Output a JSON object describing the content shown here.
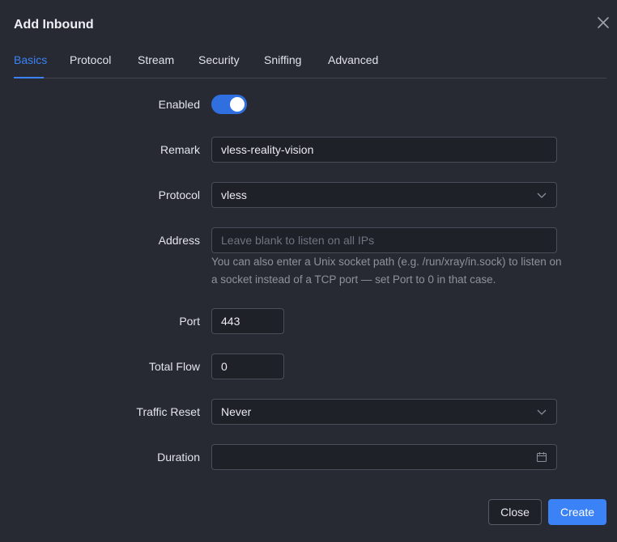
{
  "dialog": {
    "title": "Add Inbound"
  },
  "tabs": [
    {
      "label": "Basics"
    },
    {
      "label": "Protocol"
    },
    {
      "label": "Stream"
    },
    {
      "label": "Security"
    },
    {
      "label": "Sniffing"
    },
    {
      "label": "Advanced"
    }
  ],
  "active_tab": "Basics",
  "form": {
    "enabled": {
      "label": "Enabled",
      "value": true
    },
    "remark": {
      "label": "Remark",
      "value": "vless-reality-vision"
    },
    "protocol": {
      "label": "Protocol",
      "value": "vless"
    },
    "address": {
      "label": "Address",
      "value": "",
      "placeholder": "Leave blank to listen on all IPs",
      "help": "You can also enter a Unix socket path (e.g. /run/xray/in.sock) to listen on a socket instead of a TCP port — set Port to 0 in that case."
    },
    "port": {
      "label": "Port",
      "value": "443"
    },
    "total_flow": {
      "label": "Total Flow",
      "value": "0"
    },
    "traffic_reset": {
      "label": "Traffic Reset",
      "value": "Never"
    },
    "duration": {
      "label": "Duration",
      "value": ""
    }
  },
  "footer": {
    "close_label": "Close",
    "create_label": "Create"
  },
  "colors": {
    "accent": "#3b82f6",
    "background": "#272a33",
    "input_bg": "#1f2128"
  }
}
